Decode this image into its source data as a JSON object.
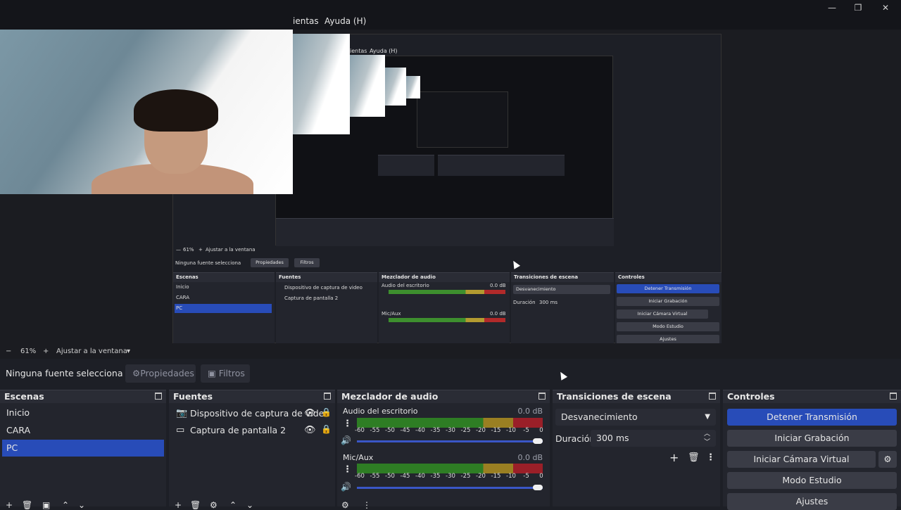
{
  "window": {
    "minimize_icon": "minimize-icon",
    "maximize_icon": "restore-icon",
    "close_icon": "close-icon"
  },
  "menubar": {
    "tools_partial": "ientas",
    "help": "Ayuda (H)"
  },
  "preview": {
    "inner": {
      "tools_partial": "ientas",
      "help": "Ayuda (H)",
      "context_label": "Ninguna fuente selecciona",
      "properties": "Propiedades",
      "filters": "Filtros",
      "zoom_minus": "−",
      "zoom_value": "61%",
      "zoom_plus": "+",
      "zoom_fit": "Ajustar a la ventana",
      "scenes_title": "Escenas",
      "scenes": [
        "Inicio",
        "CARA",
        "PC"
      ],
      "sources_title": "Fuentes",
      "sources": [
        "Dispositivo de captura de video",
        "Captura de pantalla 2"
      ],
      "mixer_title": "Mezclador de audio",
      "mixer_ch1": "Audio del escritorio",
      "mixer_ch1_db": "0.0 dB",
      "mixer_ch2": "Mic/Aux",
      "mixer_ch2_db": "0.0 dB",
      "transitions_title": "Transiciones de escena",
      "transition_type": "Desvanecimiento",
      "duration_label": "Duración",
      "duration_value": "300 ms",
      "controls_title": "Controles",
      "controls": [
        "Detener Transmisión",
        "Iniciar Grabación",
        "Iniciar Cámara Virtual",
        "Modo Estudio",
        "Ajustes"
      ]
    }
  },
  "zoom": {
    "minus": "−",
    "value": "61%",
    "plus": "+",
    "fit": "Ajustar a la ventana",
    "dropdown": "▾"
  },
  "context": {
    "label": "Ninguna fuente selecciona",
    "properties": "Propiedades",
    "filters": "Filtros"
  },
  "scenes": {
    "title": "Escenas",
    "items": [
      "Inicio",
      "CARA",
      "PC"
    ],
    "selected": "PC"
  },
  "sources": {
    "title": "Fuentes",
    "items": [
      {
        "label": "Dispositivo de captura de video",
        "icon": "camera-icon"
      },
      {
        "label": "Captura de pantalla 2",
        "icon": "monitor-icon"
      }
    ]
  },
  "mixer": {
    "title": "Mezclador de audio",
    "ticks": [
      "-60",
      "-55",
      "-50",
      "-45",
      "-40",
      "-35",
      "-30",
      "-25",
      "-20",
      "-15",
      "-10",
      "-5",
      "0"
    ],
    "channels": [
      {
        "name": "Audio del escritorio",
        "db": "0.0 dB",
        "volume": 1.0
      },
      {
        "name": "Mic/Aux",
        "db": "0.0 dB",
        "volume": 1.0
      }
    ]
  },
  "transitions": {
    "title": "Transiciones de escena",
    "type": "Desvanecimiento",
    "duration_label": "Duración",
    "duration_value": "300 ms"
  },
  "controls": {
    "title": "Controles",
    "stop_stream": "Detener Transmisión",
    "start_recording": "Iniciar Grabación",
    "start_virtual_cam": "Iniciar Cámara Virtual",
    "studio_mode": "Modo Estudio",
    "settings": "Ajustes"
  },
  "colors": {
    "accent": "#284cb8",
    "background": "#1d1f26",
    "panel": "#23252d"
  }
}
